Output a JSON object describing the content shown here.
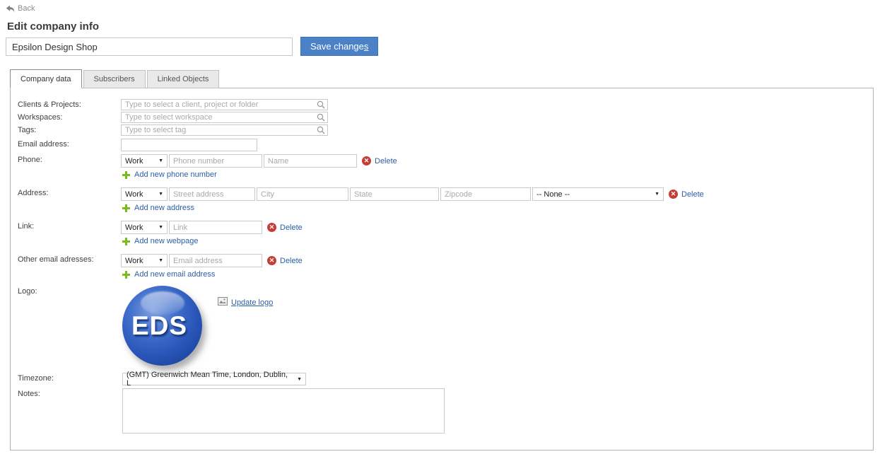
{
  "colors": {
    "accent_blue": "#4b81c6",
    "link_blue": "#2a5fa5",
    "add_green": "#79bc1d",
    "delete_red": "#c63d35",
    "panel_border": "#b2b2b2",
    "logo_blue": "#2a57ba"
  },
  "back_label": "Back",
  "page_title": "Edit company info",
  "company_name": {
    "value": "Epsilon Design Shop"
  },
  "save_button": {
    "prefix": "Save change",
    "accesskey": "s"
  },
  "tabs": [
    {
      "label": "Company data",
      "active": true
    },
    {
      "label": "Subscribers",
      "active": false
    },
    {
      "label": "Linked Objects",
      "active": false
    }
  ],
  "form": {
    "clients": {
      "label": "Clients & Projects:",
      "placeholder": "Type to select a client, project or folder"
    },
    "workspaces": {
      "label": "Workspaces:",
      "placeholder": "Type to select workspace"
    },
    "tags": {
      "label": "Tags:",
      "placeholder": "Type to select tag"
    },
    "email": {
      "label": "Email address:",
      "value": ""
    },
    "phone": {
      "label": "Phone:",
      "type_value": "Work",
      "number_placeholder": "Phone number",
      "name_placeholder": "Name",
      "delete_label": "Delete",
      "add_label": "Add new phone number"
    },
    "address": {
      "label": "Address:",
      "type_value": "Work",
      "street_placeholder": "Street address",
      "city_placeholder": "City",
      "state_placeholder": "State",
      "zip_placeholder": "Zipcode",
      "country_value": "-- None --",
      "delete_label": "Delete",
      "add_label": "Add new address"
    },
    "link": {
      "label": "Link:",
      "type_value": "Work",
      "link_placeholder": "Link",
      "delete_label": "Delete",
      "add_label": "Add new webpage"
    },
    "other_emails": {
      "label": "Other email adresses:",
      "type_value": "Work",
      "email_placeholder": "Email address",
      "delete_label": "Delete",
      "add_label": "Add new email address"
    },
    "logo": {
      "label": "Logo:",
      "logo_text": "EDS",
      "update_label": "Update logo"
    },
    "timezone": {
      "label": "Timezone:",
      "value": "(GMT) Greenwich Mean Time, London, Dublin, L"
    },
    "notes": {
      "label": "Notes:",
      "value": ""
    }
  }
}
